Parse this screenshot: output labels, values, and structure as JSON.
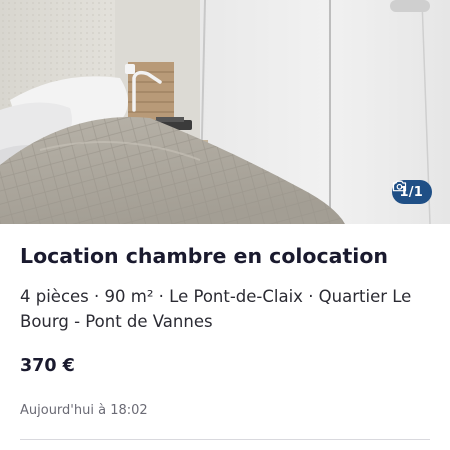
{
  "listing": {
    "image_counter": "1/1",
    "title": "Location chambre en colocation",
    "description": "4 pièces · 90 m² · Le Pont-de-Claix · Quartier Le Bourg - Pont de Vannes",
    "price": "370 €",
    "date": "Aujourd'hui à 18:02"
  },
  "icons": {
    "counter": "camera-icon"
  },
  "colors": {
    "badge_background": "#1f4f86",
    "text_primary": "#1a1a2e",
    "text_secondary": "#6b6b75"
  }
}
